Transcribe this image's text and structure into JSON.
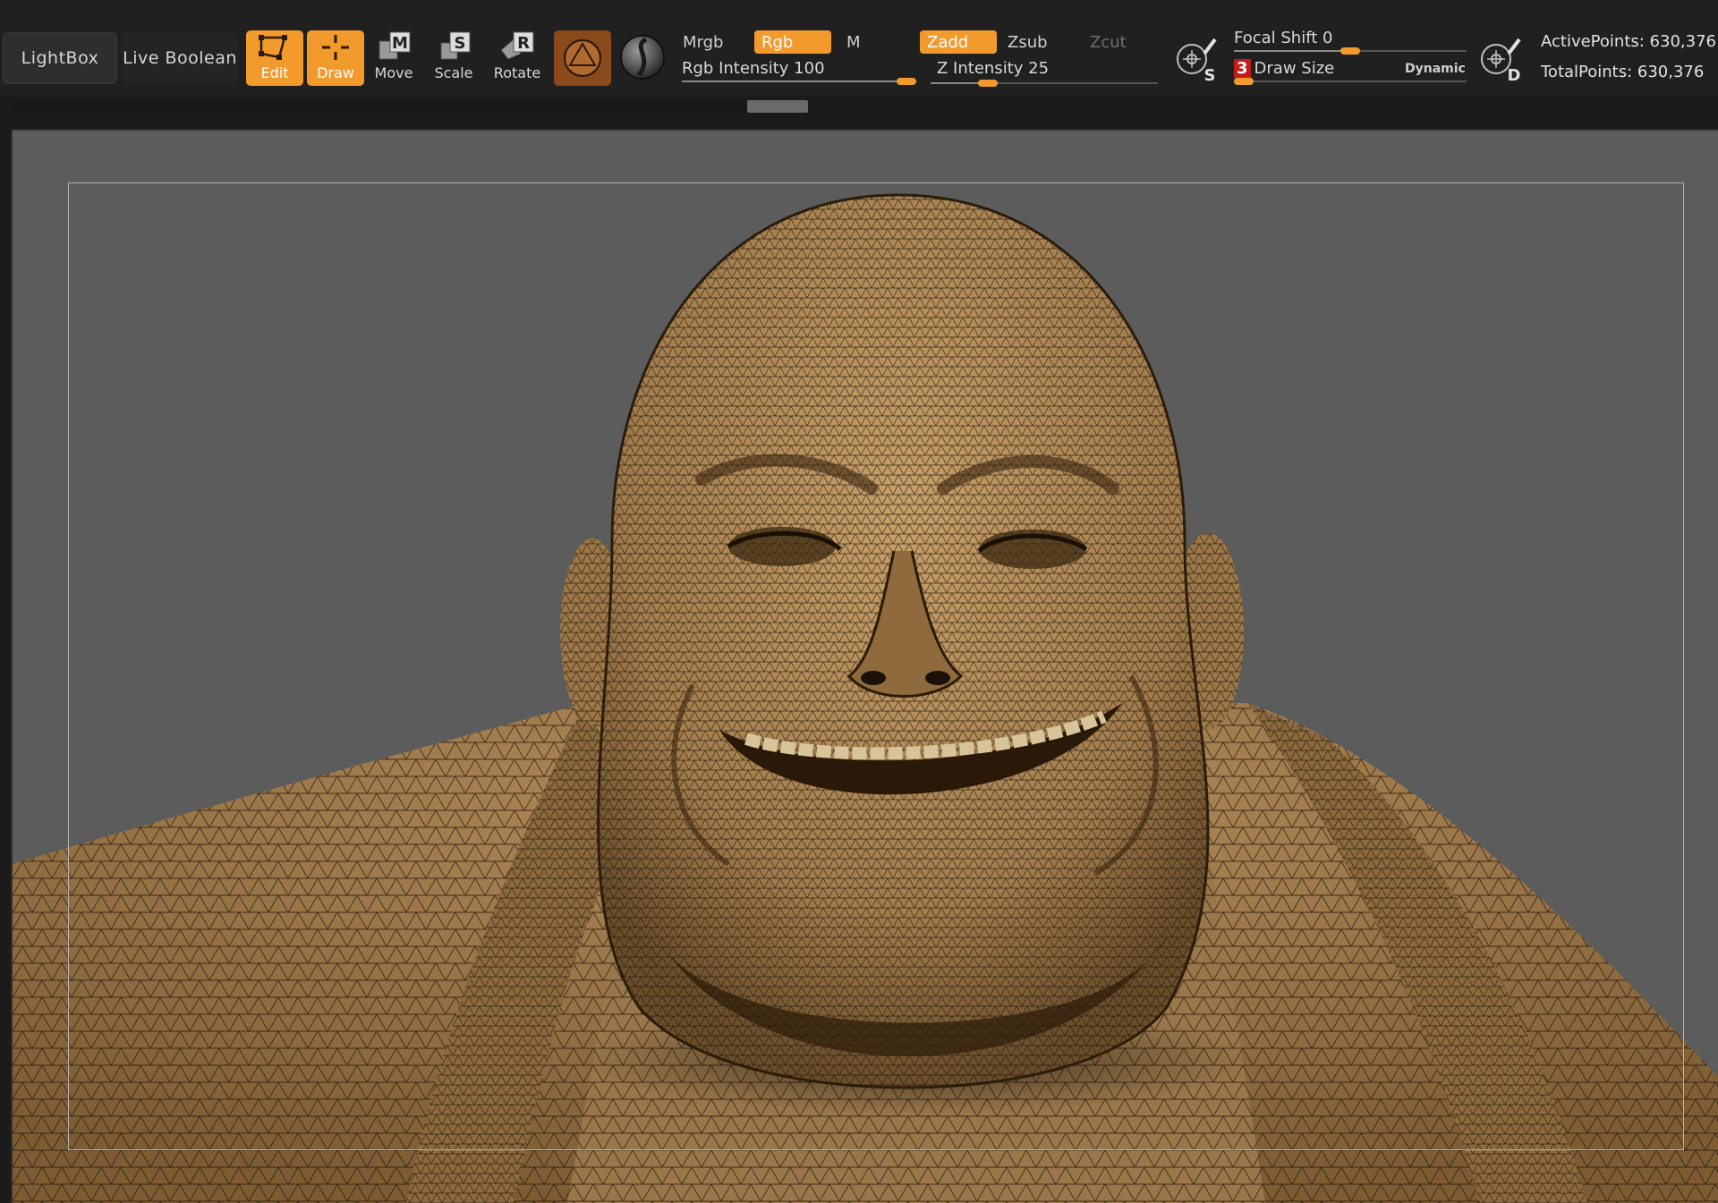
{
  "toolbar": {
    "lightbox_label": "LightBox",
    "live_boolean_label": "Live Boolean",
    "tools": {
      "edit": "Edit",
      "draw": "Draw",
      "move": "Move",
      "scale": "Scale",
      "rotate": "Rotate"
    },
    "tool_keys": {
      "move": "M",
      "scale": "S",
      "rotate": "R"
    },
    "modes": {
      "mrgb": "Mrgb",
      "rgb": "Rgb",
      "m": "M",
      "zadd": "Zadd",
      "zsub": "Zsub",
      "zcut": "Zcut"
    },
    "sliders": {
      "rgb_intensity": {
        "label": "Rgb Intensity",
        "value": "100",
        "fraction": 1.0
      },
      "z_intensity": {
        "label": "Z Intensity",
        "value": "25",
        "fraction": 0.25
      },
      "focal_shift": {
        "label": "Focal Shift",
        "value": "0",
        "fraction": 0.5
      },
      "draw_size": {
        "label": "Draw Size",
        "value": "3",
        "fraction": 0.0
      }
    },
    "dynamic_label": "Dynamic",
    "stroke_letters": {
      "s": "S",
      "d": "D"
    },
    "stats": {
      "active_points": "ActivePoints: 630,376",
      "total_points": "TotalPoints: 630,376"
    }
  },
  "colors": {
    "accent": "#f39a2d",
    "material": "#8a4a1c",
    "canvas_bg": "#5c5c5c",
    "mesh_skin": "#a88456",
    "wire": "#1e1409"
  },
  "icons": {
    "edit": "edit-icon",
    "draw": "draw-icon",
    "move": "move-icon",
    "scale": "scale-icon",
    "rotate": "rotate-icon",
    "material": "material-sphere-icon",
    "brush": "brush-sphere-icon",
    "stroke_s": "symmetry-stroke-icon",
    "stroke_d": "dynamic-stroke-icon"
  }
}
